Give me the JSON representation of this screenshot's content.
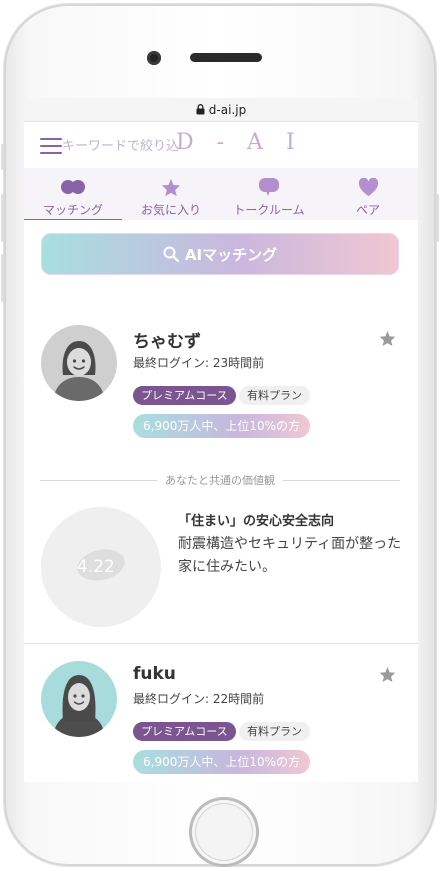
{
  "browser": {
    "url": "d-ai.jp"
  },
  "header": {
    "search_placeholder": "キーワードで絞り込",
    "logo": "D - A I"
  },
  "tabs": [
    {
      "label": "マッチング",
      "icon": "two-circles-icon",
      "active": true
    },
    {
      "label": "お気に入り",
      "icon": "star-icon",
      "active": false
    },
    {
      "label": "トークルーム",
      "icon": "chat-bubble-icon",
      "active": false
    },
    {
      "label": "ペア",
      "icon": "heart-icon",
      "active": false
    }
  ],
  "ai_button": {
    "label": "AIマッチング",
    "icon": "search-icon"
  },
  "profiles": [
    {
      "name": "ちゃむず",
      "last_login": "最終ログイン: 23時間前",
      "badge_premium": "プレミアムコース",
      "badge_paid": "有料プラン",
      "rank": "6,900万人中、上位10%の方",
      "avatar_bg": "#cfcfcf",
      "hair_color": "#4a4a4a",
      "body_color": "#6a6a6a"
    },
    {
      "name": "fuku",
      "last_login": "最終ログイン: 22時間前",
      "badge_premium": "プレミアムコース",
      "badge_paid": "有料プラン",
      "rank": "6,900万人中、上位10%の方",
      "avatar_bg": "#a8dcdc",
      "hair_color": "#4a4a4a",
      "body_color": "#4d4d4d"
    }
  ],
  "shared_values": {
    "heading": "あなたと共通の価値観",
    "score": "4.22",
    "title": "「住まい」の安心安全志向",
    "body": "耐震構造やセキュリティ面が整った家に住みたい。"
  },
  "colors": {
    "accent": "#8a62a8",
    "premium_badge": "#7b5590",
    "gradient_start": "#a7dfe0",
    "gradient_mid": "#cab7de",
    "gradient_end": "#f1c7d2"
  }
}
